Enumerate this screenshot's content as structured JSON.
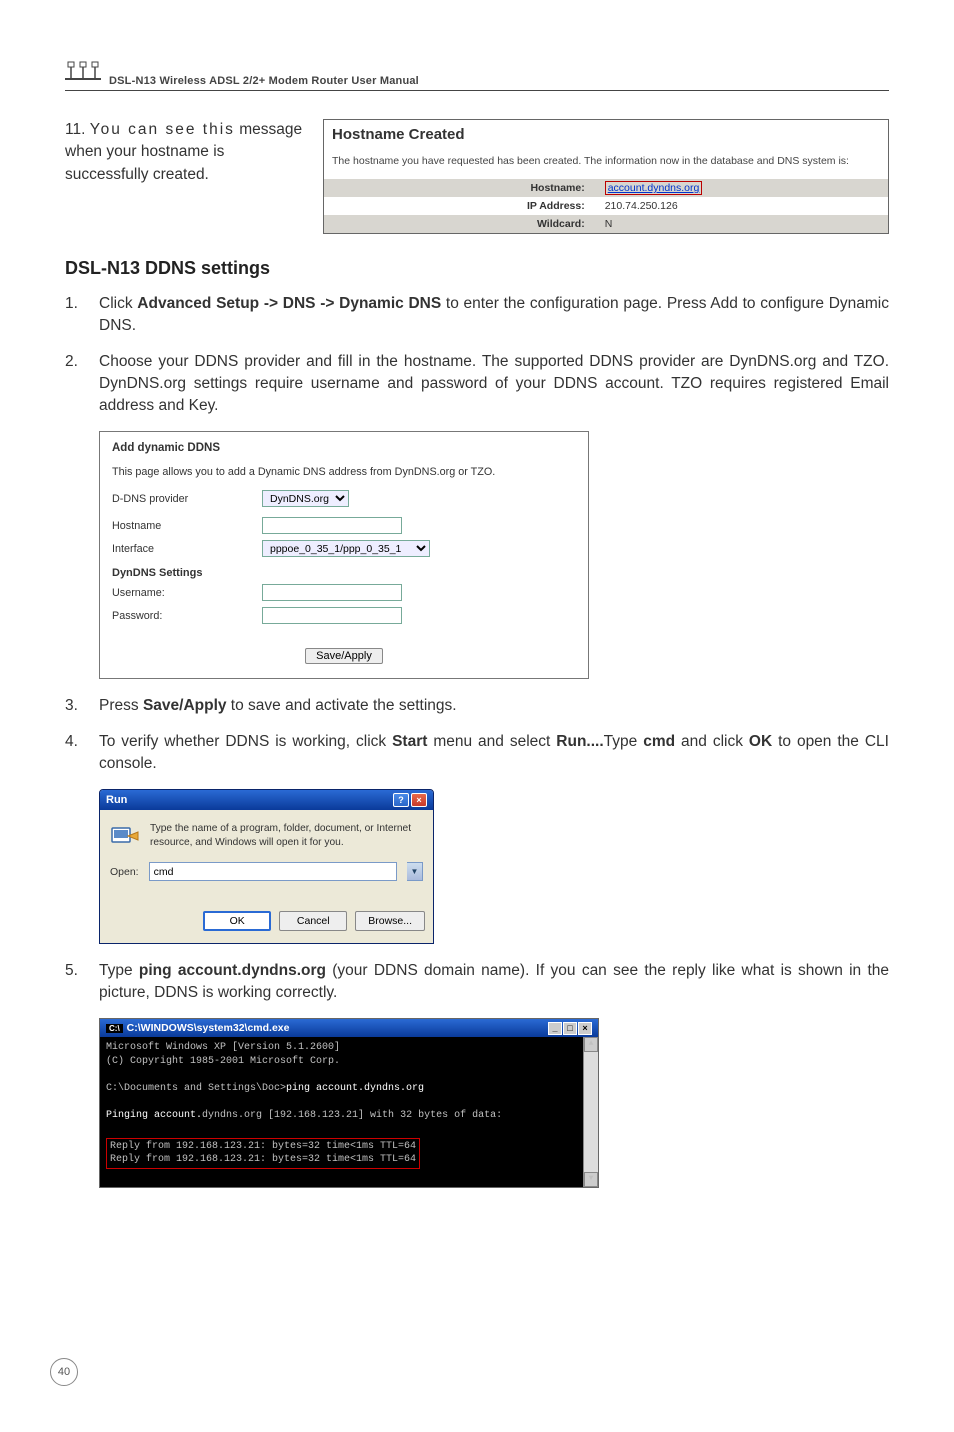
{
  "header": {
    "manual_title": "DSL-N13 Wireless ADSL 2/2+ Modem Router User Manual"
  },
  "step11": {
    "num": "11.",
    "line1": "You can see this",
    "rest": "message when your hostname is successfully created."
  },
  "hostname_created": {
    "title": "Hostname Created",
    "subtitle": "The hostname you have requested has been created. The information now in the database and DNS system is:",
    "rows": [
      {
        "label": "Hostname:",
        "value": "account.dyndns.org",
        "link": true
      },
      {
        "label": "IP Address:",
        "value": "210.74.250.126",
        "link": false
      },
      {
        "label": "Wildcard:",
        "value": "N",
        "link": false
      }
    ]
  },
  "section_heading": "DSL-N13 DDNS settings",
  "steps": {
    "s1": {
      "n": "1.",
      "t1": "Click ",
      "b1": "Advanced Setup -> DNS -> Dynamic DNS",
      "t2": " to enter the configuration page. Press Add to configure Dynamic DNS."
    },
    "s2": {
      "n": "2.",
      "t": "Choose your DDNS provider and fill in the hostname. The supported DDNS provider are DynDNS.org and TZO. DynDNS.org settings require username and password of your DDNS account. TZO requires registered Email address and Key."
    },
    "s3": {
      "n": "3.",
      "t1": "Press ",
      "b1": "Save/Apply",
      "t2": " to save and activate the settings."
    },
    "s4": {
      "n": "4.",
      "t1": "To verify whether DDNS is working, click ",
      "b1": "Start",
      "t2": " menu and select ",
      "b2": "Run....",
      "t3": "Type ",
      "b3": "cmd",
      "t4": " and click ",
      "b4": "OK",
      "t5": " to open the CLI console."
    },
    "s5": {
      "n": "5.",
      "t1": "Type ",
      "b1": "ping account.dyndns.org",
      "t2": " (your DDNS domain name). If you can see the reply like what is shown in the picture, DDNS is working correctly."
    }
  },
  "ddns_form": {
    "title": "Add dynamic DDNS",
    "desc": "This page allows you to add a Dynamic DNS address from DynDNS.org or TZO.",
    "provider_label": "D-DNS provider",
    "provider_value": "DynDNS.org",
    "hostname_label": "Hostname",
    "interface_label": "Interface",
    "interface_value": "pppoe_0_35_1/ppp_0_35_1",
    "settings_heading": "DynDNS Settings",
    "username_label": "Username:",
    "password_label": "Password:",
    "save_label": "Save/Apply"
  },
  "run_dialog": {
    "title": "Run",
    "desc": "Type the name of a program, folder, document, or Internet resource, and Windows will open it for you.",
    "open_label": "Open:",
    "open_value": "cmd",
    "ok": "OK",
    "cancel": "Cancel",
    "browse": "Browse..."
  },
  "cmd": {
    "title": "C:\\WINDOWS\\system32\\cmd.exe",
    "l1": "Microsoft Windows XP [Version 5.1.2600]",
    "l2": "(C) Copyright 1985-2001 Microsoft Corp.",
    "l3a": "C:\\Documents and Settings\\Doc>",
    "l3b": "ping account.dyndns.org",
    "l4a": "Pinging ",
    "l4b": "account.",
    "l4c": "dyndns.org [192.168.123.21] with 32 bytes of data:",
    "l5": "Reply from 192.168.123.21: bytes=32 time<1ms TTL=64",
    "l6": "Reply from 192.168.123.21: bytes=32 time<1ms TTL=64"
  },
  "page_number": "40"
}
